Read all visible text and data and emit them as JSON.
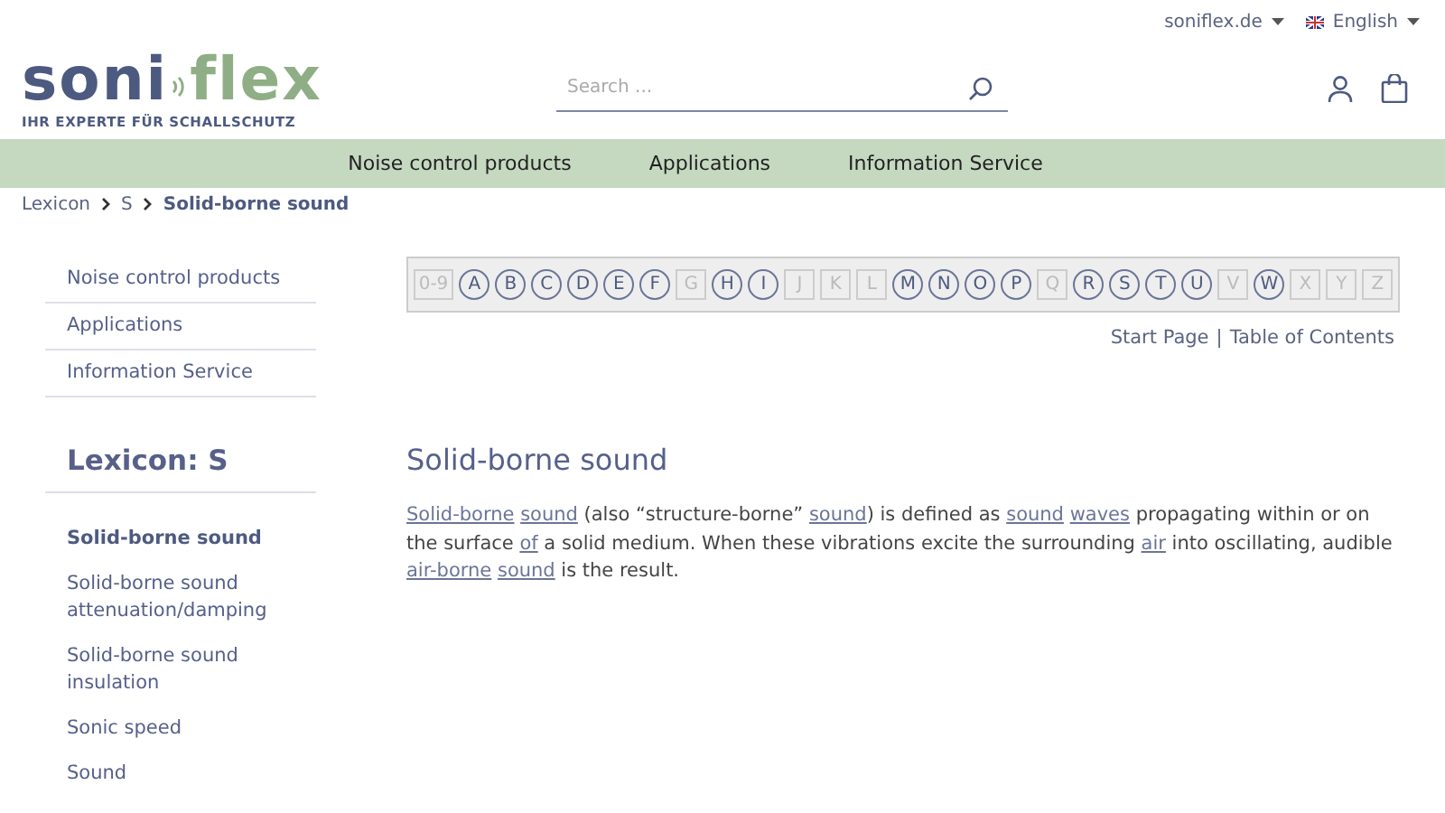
{
  "top_bar": {
    "site": "soniflex.de",
    "language": "English"
  },
  "logo": {
    "part_1": "soni",
    "part_2": "flex",
    "tagline": "IHR EXPERTE FÜR SCHALLSCHUTZ"
  },
  "search": {
    "placeholder": "Search ..."
  },
  "nav": [
    "Noise control products",
    "Applications",
    "Information Service"
  ],
  "breadcrumb": [
    {
      "label": "Lexicon",
      "current": false
    },
    {
      "label": "S",
      "current": false
    },
    {
      "label": "Solid-borne sound",
      "current": true
    }
  ],
  "sidebar": {
    "menu": [
      "Noise control products",
      "Applications",
      "Information Service"
    ],
    "heading": "Lexicon: S",
    "items": [
      {
        "label": "Solid-borne sound",
        "selected": true
      },
      {
        "label": "Solid-borne sound attenuation/damping",
        "selected": false
      },
      {
        "label": "Solid-borne sound insulation",
        "selected": false
      },
      {
        "label": "Sonic speed",
        "selected": false
      },
      {
        "label": "Sound",
        "selected": false
      }
    ]
  },
  "letters": [
    {
      "label": "0-9",
      "disabled": true
    },
    {
      "label": "A",
      "disabled": false
    },
    {
      "label": "B",
      "disabled": false
    },
    {
      "label": "C",
      "disabled": false
    },
    {
      "label": "D",
      "disabled": false
    },
    {
      "label": "E",
      "disabled": false
    },
    {
      "label": "F",
      "disabled": false
    },
    {
      "label": "G",
      "disabled": true
    },
    {
      "label": "H",
      "disabled": false
    },
    {
      "label": "I",
      "disabled": false
    },
    {
      "label": "J",
      "disabled": true
    },
    {
      "label": "K",
      "disabled": true
    },
    {
      "label": "L",
      "disabled": true
    },
    {
      "label": "M",
      "disabled": false
    },
    {
      "label": "N",
      "disabled": false
    },
    {
      "label": "O",
      "disabled": false
    },
    {
      "label": "P",
      "disabled": false
    },
    {
      "label": "Q",
      "disabled": true
    },
    {
      "label": "R",
      "disabled": false
    },
    {
      "label": "S",
      "disabled": false
    },
    {
      "label": "T",
      "disabled": false
    },
    {
      "label": "U",
      "disabled": false
    },
    {
      "label": "V",
      "disabled": true
    },
    {
      "label": "W",
      "disabled": false
    },
    {
      "label": "X",
      "disabled": true
    },
    {
      "label": "Y",
      "disabled": true
    },
    {
      "label": "Z",
      "disabled": true
    }
  ],
  "links": [
    "Start Page",
    "|",
    "Table of Contents"
  ],
  "article": {
    "title": "Solid-borne sound",
    "body": [
      {
        "kind": "link",
        "text": "Solid-borne"
      },
      {
        "kind": "link",
        "text": "sound"
      },
      {
        "kind": "text",
        "text": " (also “structure-borne” "
      },
      {
        "kind": "link",
        "text": "sound"
      },
      {
        "kind": "text",
        "text": ") is defined as "
      },
      {
        "kind": "link",
        "text": "sound"
      },
      {
        "kind": "link",
        "text": "waves"
      },
      {
        "kind": "text",
        "text": " propagating within or on the surface "
      },
      {
        "kind": "link",
        "text": "of"
      },
      {
        "kind": "text",
        "text": " a solid medium. When these vibrations excite the surrounding "
      },
      {
        "kind": "link",
        "text": "air"
      },
      {
        "kind": "text",
        "text": " into oscillating, audible "
      },
      {
        "kind": "link",
        "text": "air-borne"
      },
      {
        "kind": "link",
        "text": "sound"
      },
      {
        "kind": "text",
        "text": " is the result."
      }
    ]
  }
}
